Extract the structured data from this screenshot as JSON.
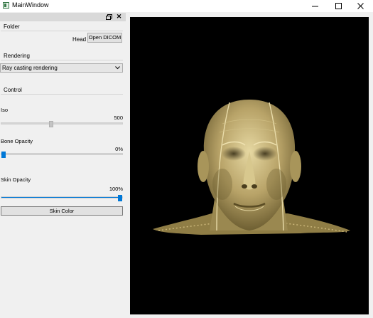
{
  "window": {
    "title": "MainWindow"
  },
  "folder": {
    "title": "Folder",
    "label": "Head",
    "open_button": "Open DICOM"
  },
  "rendering": {
    "title": "Rendering",
    "selected": "Ray casting rendering"
  },
  "control": {
    "title": "Control",
    "iso": {
      "label": "Iso",
      "value": "500",
      "fraction": 0.41
    },
    "bone": {
      "label": "Bone Opacity",
      "value": "0%",
      "fraction": 0.0
    },
    "skin": {
      "label": "Skin Opacity",
      "value": "100%",
      "fraction": 1.0
    },
    "skin_color_button": "Skin Color"
  },
  "colors": {
    "accent": "#0078d7",
    "render_background": "#000000",
    "skin_tone": "#c8b67a"
  }
}
